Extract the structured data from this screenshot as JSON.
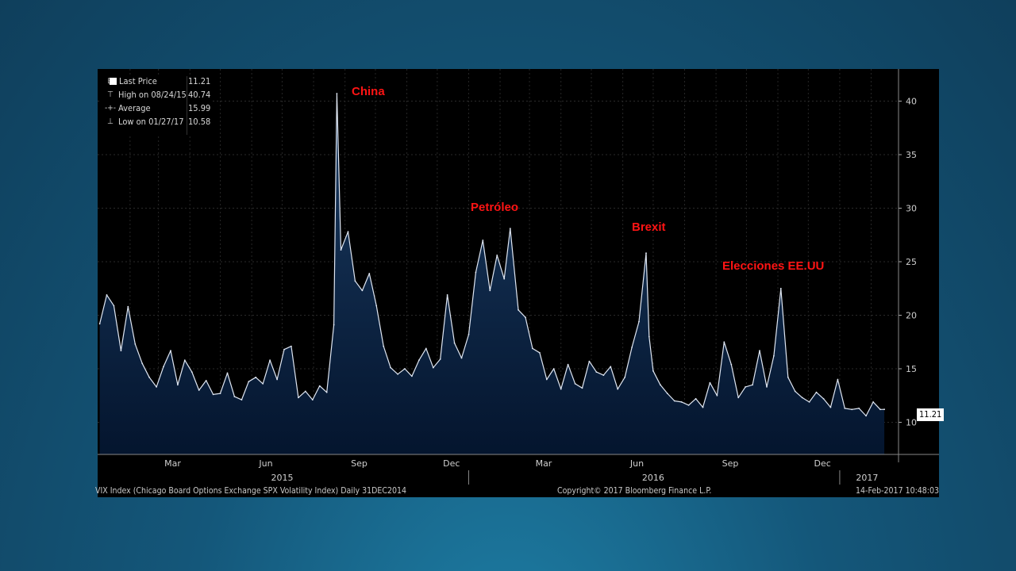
{
  "legend": {
    "last_price_label": "Last Price",
    "last_price": "11.21",
    "high_label": "High on 08/24/15",
    "high": "40.74",
    "average_label": "Average",
    "average": "15.99",
    "low_label": "Low on 01/27/17",
    "low": "10.58"
  },
  "annotations": [
    "China",
    "Petróleo",
    "Brexit",
    "Elecciones EE.UU"
  ],
  "footer": {
    "left": "VIX Index (Chicago Board Options Exchange SPX Volatility Index)  Daily 31DEC2014",
    "center": "Copyright© 2017 Bloomberg Finance L.P.",
    "right": "14-Feb-2017 10:48:03"
  },
  "price_tag": "11.21",
  "colors": {
    "line": "#dfe6f2",
    "fill_top": "#1b3c63",
    "fill_bottom": "#04152e",
    "annotation": "#ff1414",
    "background": "#000000"
  },
  "chart_data": {
    "type": "area",
    "ylim": [
      7,
      43
    ],
    "y_ticks": [
      10,
      15,
      20,
      25,
      30,
      35,
      40
    ],
    "y_axis_position": "right",
    "grid": true,
    "month_ticks": [
      "Mar",
      "Jun",
      "Sep",
      "Dec",
      "Mar",
      "Jun",
      "Sep",
      "Dec"
    ],
    "year_labels": [
      "2015",
      "2016",
      "2017"
    ],
    "x": [
      "2015-01-02",
      "2015-01-09",
      "2015-01-16",
      "2015-01-23",
      "2015-01-30",
      "2015-02-06",
      "2015-02-13",
      "2015-02-20",
      "2015-02-27",
      "2015-03-06",
      "2015-03-13",
      "2015-03-20",
      "2015-03-27",
      "2015-04-03",
      "2015-04-10",
      "2015-04-17",
      "2015-04-24",
      "2015-05-01",
      "2015-05-08",
      "2015-05-15",
      "2015-05-22",
      "2015-05-29",
      "2015-06-05",
      "2015-06-12",
      "2015-06-19",
      "2015-06-26",
      "2015-07-03",
      "2015-07-10",
      "2015-07-17",
      "2015-07-24",
      "2015-07-31",
      "2015-08-07",
      "2015-08-14",
      "2015-08-21",
      "2015-08-24",
      "2015-08-28",
      "2015-09-04",
      "2015-09-11",
      "2015-09-18",
      "2015-09-25",
      "2015-10-02",
      "2015-10-09",
      "2015-10-16",
      "2015-10-23",
      "2015-10-30",
      "2015-11-06",
      "2015-11-13",
      "2015-11-20",
      "2015-11-27",
      "2015-12-04",
      "2015-12-11",
      "2015-12-18",
      "2015-12-25",
      "2016-01-01",
      "2016-01-08",
      "2016-01-15",
      "2016-01-22",
      "2016-01-29",
      "2016-02-05",
      "2016-02-11",
      "2016-02-19",
      "2016-02-26",
      "2016-03-04",
      "2016-03-11",
      "2016-03-18",
      "2016-03-25",
      "2016-04-01",
      "2016-04-08",
      "2016-04-15",
      "2016-04-22",
      "2016-04-29",
      "2016-05-06",
      "2016-05-13",
      "2016-05-20",
      "2016-05-27",
      "2016-06-03",
      "2016-06-10",
      "2016-06-17",
      "2016-06-24",
      "2016-06-27",
      "2016-07-01",
      "2016-07-08",
      "2016-07-15",
      "2016-07-22",
      "2016-07-29",
      "2016-08-05",
      "2016-08-12",
      "2016-08-19",
      "2016-08-26",
      "2016-09-02",
      "2016-09-09",
      "2016-09-16",
      "2016-09-23",
      "2016-09-30",
      "2016-10-07",
      "2016-10-14",
      "2016-10-21",
      "2016-10-28",
      "2016-11-04",
      "2016-11-11",
      "2016-11-18",
      "2016-11-25",
      "2016-12-02",
      "2016-12-09",
      "2016-12-16",
      "2016-12-23",
      "2016-12-30",
      "2017-01-06",
      "2017-01-13",
      "2017-01-20",
      "2017-01-27",
      "2017-02-03",
      "2017-02-10",
      "2017-02-14"
    ],
    "series": [
      {
        "values": [
          19.2,
          21.9,
          20.9,
          16.7,
          20.8,
          17.3,
          15.5,
          14.2,
          13.3,
          15.2,
          16.7,
          13.5,
          15.8,
          14.7,
          13.0,
          13.9,
          12.6,
          12.7,
          14.6,
          12.4,
          12.1,
          13.8,
          14.2,
          13.6,
          15.8,
          14.0,
          16.8,
          17.1,
          12.3,
          12.9,
          12.1,
          13.4,
          12.8,
          19.1,
          40.7,
          26.1,
          27.8,
          23.2,
          22.3,
          23.9,
          20.9,
          17.1,
          15.1,
          14.5,
          15.0,
          14.3,
          15.8,
          16.9,
          15.1,
          15.9,
          21.9,
          17.4,
          16.0,
          18.2,
          24.0,
          27.0,
          22.3,
          25.6,
          23.4,
          28.1,
          20.5,
          19.8,
          16.9,
          16.5,
          14.0,
          15.0,
          13.1,
          15.4,
          13.6,
          13.2,
          15.7,
          14.7,
          14.4,
          15.2,
          13.1,
          14.2,
          17.0,
          19.4,
          25.8,
          18.0,
          14.8,
          13.5,
          12.7,
          12.0,
          11.9,
          11.6,
          12.2,
          11.4,
          13.7,
          12.5,
          17.5,
          15.4,
          12.3,
          13.3,
          13.5,
          16.7,
          13.3,
          16.2,
          22.5,
          14.2,
          12.9,
          12.3,
          11.9,
          12.8,
          12.2,
          11.4,
          14.0,
          11.3,
          11.2,
          11.3,
          10.6,
          11.9,
          11.2,
          11.21
        ]
      }
    ]
  }
}
